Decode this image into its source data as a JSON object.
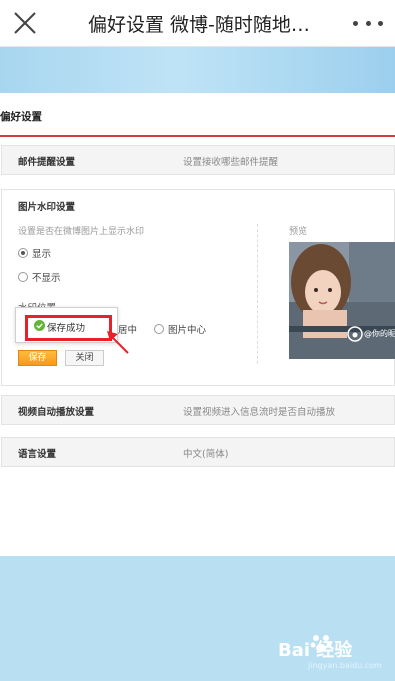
{
  "appbar": {
    "title": "偏好设置 微博-随时随地…",
    "close_icon": "close-icon",
    "more_icon": "more-dots-icon"
  },
  "page": {
    "section_title": "偏好设置"
  },
  "rows": {
    "email": {
      "label": "邮件提醒设置",
      "desc": "设置接收哪些邮件提醒"
    },
    "video": {
      "label": "视频自动播放设置",
      "desc": "设置视频进入信息流时是否自动播放"
    },
    "language": {
      "label": "语言设置",
      "desc": "中文(简体)"
    }
  },
  "watermark": {
    "title": "图片水印设置",
    "desc": "设置是否在微博图片上显示水印",
    "show_label": "显示",
    "hide_label": "不显示",
    "show_selected": true,
    "position_label": "水印位置",
    "pos_center": "居中",
    "pos_image_center": "图片中心",
    "save_label": "保存",
    "close_label": "关闭",
    "preview_label": "预览",
    "preview_watermark": "@你的昵"
  },
  "toast": {
    "text": "保存成功",
    "icon": "check-circle-icon"
  },
  "colors": {
    "accent_red": "#d23c3c",
    "save_orange": "#f7991e",
    "banner_blue": "#a8d6f0",
    "bottom_blue": "#b9dff2"
  },
  "footer": {
    "logo_text": "Bai 经验",
    "url": "jingyan.baidu.com"
  }
}
